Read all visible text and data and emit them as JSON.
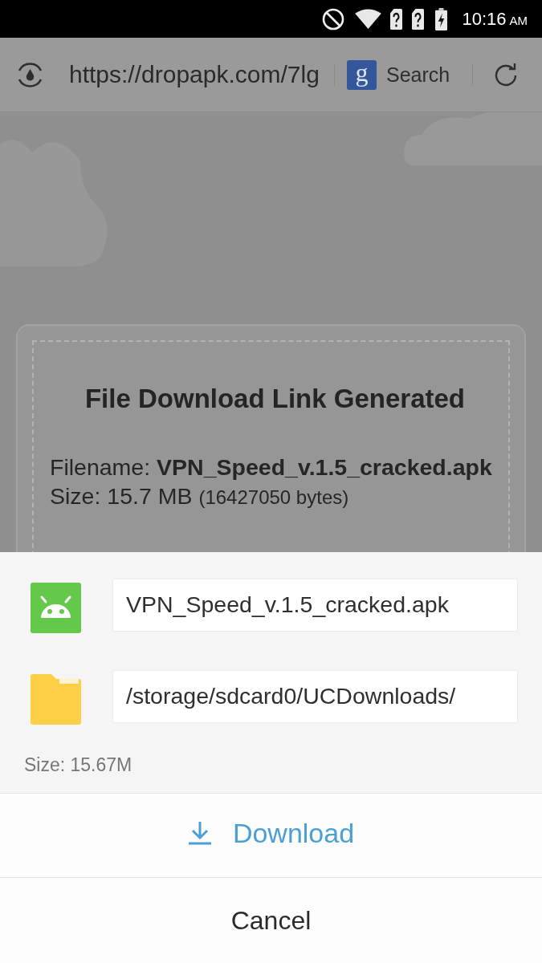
{
  "status_bar": {
    "time": "10:16",
    "am_pm": "AM"
  },
  "toolbar": {
    "url": "https://dropapk.com/7lg",
    "search_engine_letter": "g",
    "search_label": "Search"
  },
  "page": {
    "card": {
      "title": "File Download Link Generated",
      "filename_line": "Filename: **VPN_Speed_v.1.5_cracked.apk**",
      "size": "Size: 15.7 MB",
      "size_bytes": "(16427050 bytes)"
    }
  },
  "download_dialog": {
    "fields": [
      {
        "kind": "file",
        "value": "VPN_Speed_v.1.5_cracked.apk"
      },
      {
        "kind": "folder",
        "value": "/storage/sdcard0/UCDownloads/"
      }
    ],
    "size": "Size: 15.67M",
    "buttons": [
      {
        "kind": "primary",
        "label": "Download"
      },
      {
        "kind": "secondary",
        "label": "Cancel"
      }
    ]
  }
}
